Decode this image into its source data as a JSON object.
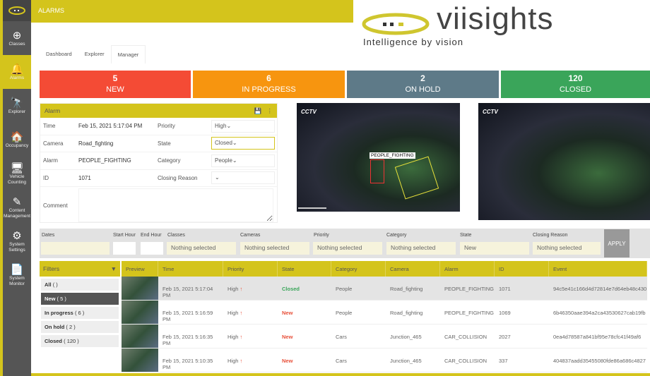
{
  "header": {
    "title": "ALARMS"
  },
  "brand": {
    "name": "viisights",
    "tagline": "Intelligence by vision",
    "accent": "#d4c41c"
  },
  "sidebar": {
    "items": [
      {
        "label": "Classes",
        "icon": "crosshair-icon"
      },
      {
        "label": "Alarms",
        "icon": "bell-icon",
        "active": true
      },
      {
        "label": "Explorer",
        "icon": "telescope-icon"
      },
      {
        "label": "Occupancy",
        "icon": "home-icon"
      },
      {
        "label": "Vehicle Counting",
        "icon": "monitor-icon"
      },
      {
        "label": "Content Management",
        "icon": "edit-icon"
      },
      {
        "label": "System Settings",
        "icon": "gear-icon"
      },
      {
        "label": "System Monitor",
        "icon": "file-pulse-icon"
      }
    ]
  },
  "tabs": [
    {
      "label": "Dashboard"
    },
    {
      "label": "Explorer"
    },
    {
      "label": "Manager",
      "active": true
    }
  ],
  "stats": [
    {
      "count": "5",
      "label": "NEW",
      "color": "#f44b35"
    },
    {
      "count": "6",
      "label": "IN PROGRESS",
      "color": "#f7950f"
    },
    {
      "count": "2",
      "label": "ON HOLD",
      "color": "#5e7a88"
    },
    {
      "count": "120",
      "label": "CLOSED",
      "color": "#3aa55a"
    }
  ],
  "alarm": {
    "title": "Alarm",
    "time_label": "Time",
    "time": "Feb 15, 2021 5:17:04 PM",
    "camera_label": "Camera",
    "camera": "Road_fighting",
    "alarm_label": "Alarm",
    "alarm": "PEOPLE_FIGHTING",
    "id_label": "ID",
    "id": "1071",
    "priority_label": "Priority",
    "priority": "High",
    "state_label": "State",
    "state": "Closed",
    "category_label": "Category",
    "category": "People",
    "closing_label": "Closing Reason",
    "closing": "",
    "comment_label": "Comment"
  },
  "video": {
    "logo": "CCTV",
    "detection_label": "PEOPLE_FIGHTING"
  },
  "filterbar": {
    "dates": "Dates",
    "start": "Start Hour",
    "end": "End Hour",
    "classes": "Classes",
    "classes_val": "Nothing selected",
    "cameras": "Cameras",
    "cameras_val": "Nothing selected",
    "priority": "Priority",
    "priority_val": "Nothing selected",
    "category": "Category",
    "category_val": "Nothing selected",
    "state": "State",
    "state_val": "New",
    "closing": "Closing Reason",
    "closing_val": "Nothing selected",
    "apply": "APPLY"
  },
  "filters": {
    "title": "Filters",
    "items": [
      {
        "label": "All",
        "count": "( )"
      },
      {
        "label": "New",
        "count": "( 5 )",
        "active": true
      },
      {
        "label": "In progress",
        "count": "( 6 )"
      },
      {
        "label": "On hold",
        "count": "( 2 )"
      },
      {
        "label": "Closed",
        "count": "( 120 )"
      }
    ]
  },
  "table": {
    "columns": [
      "Preview",
      "Time",
      "Priority",
      "State",
      "Category",
      "Camera",
      "Alarm",
      "ID",
      "Event"
    ],
    "rows": [
      {
        "time": "Feb 15, 2021 5:17:04 PM",
        "priority": "High",
        "state": "Closed",
        "category": "People",
        "camera": "Road_fighting",
        "alarm": "PEOPLE_FIGHTING",
        "id": "1071",
        "event": "94c5e41c166d4d72814e7d64eb48c430"
      },
      {
        "time": "Feb 15, 2021 5:16:59 PM",
        "priority": "High",
        "state": "New",
        "category": "People",
        "camera": "Road_fighting",
        "alarm": "PEOPLE_FIGHTING",
        "id": "1069",
        "event": "6b46350aae394a2ca43530627cab19fb"
      },
      {
        "time": "Feb 15, 2021 5:16:35 PM",
        "priority": "High",
        "state": "New",
        "category": "Cars",
        "camera": "Junction_465",
        "alarm": "CAR_COLLISION",
        "id": "2027",
        "event": "0ea4d78587a841bf95e78cfc41f49af6"
      },
      {
        "time": "Feb 15, 2021 5:10:35 PM",
        "priority": "High",
        "state": "New",
        "category": "Cars",
        "camera": "Junction_465",
        "alarm": "CAR_COLLISION",
        "id": "337",
        "event": "404837aadd35455080fde86a686c4827"
      }
    ]
  },
  "colors": {
    "closed": "#3aa55a",
    "new": "#e8503a",
    "priority_up": "#e8503a"
  }
}
